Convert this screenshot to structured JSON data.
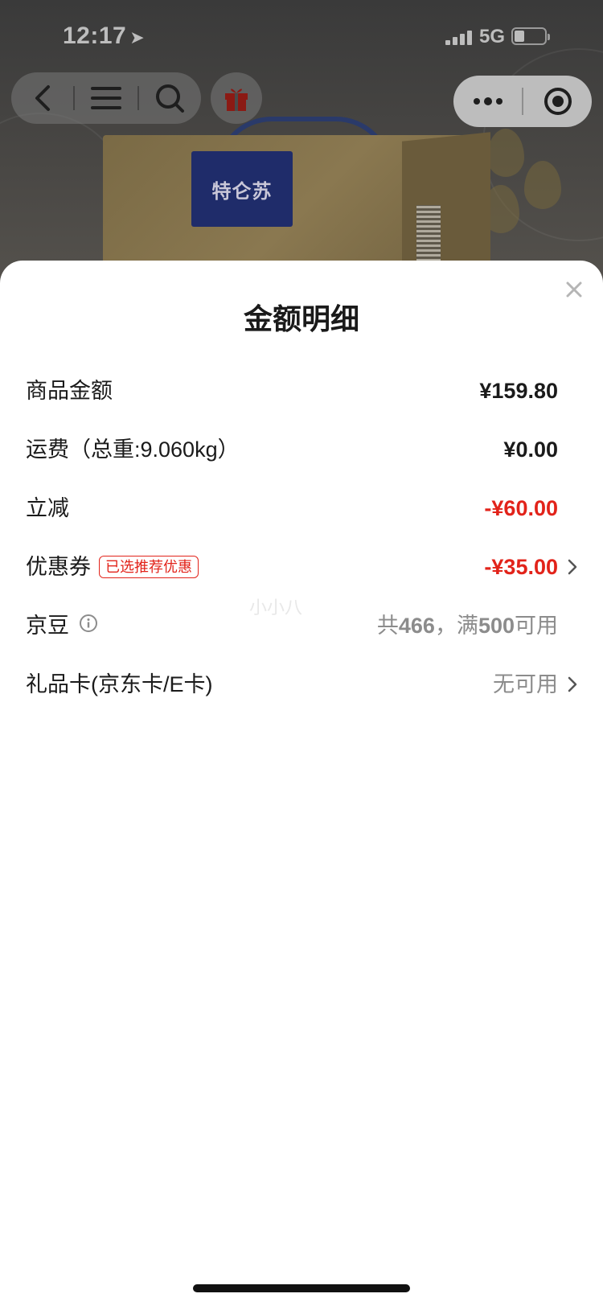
{
  "status_bar": {
    "time": "12:17",
    "network": "5G"
  },
  "background": {
    "brand_label": "特仑苏"
  },
  "sheet": {
    "title": "金额明细",
    "rows": [
      {
        "label": "商品金额",
        "value": "¥159.80"
      },
      {
        "label": "运费（总重:9.060kg）",
        "value": "¥0.00"
      },
      {
        "label": "立减",
        "value": "-¥60.00"
      },
      {
        "label": "优惠券",
        "tag": "已选推荐优惠",
        "value": "-¥35.00"
      },
      {
        "label": "京豆",
        "value_prefix": "共",
        "value_count": "466",
        "value_sep": "，满",
        "value_threshold": "500",
        "value_suffix": "可用"
      },
      {
        "label": "礼品卡(京东卡/E卡)",
        "value": "无可用"
      }
    ],
    "watermark": "小小八"
  },
  "colors": {
    "accent_red": "#e2231a",
    "muted_text": "#8c8c8c",
    "main_text": "#1a1a1a"
  },
  "icons": {
    "back": "chevron-left-icon",
    "menu": "menu-icon",
    "search": "search-icon",
    "gift": "gift-icon",
    "more": "more-dots-icon",
    "close_app": "target-icon",
    "close": "close-icon",
    "info": "info-icon",
    "chevron": "chevron-right-icon"
  }
}
